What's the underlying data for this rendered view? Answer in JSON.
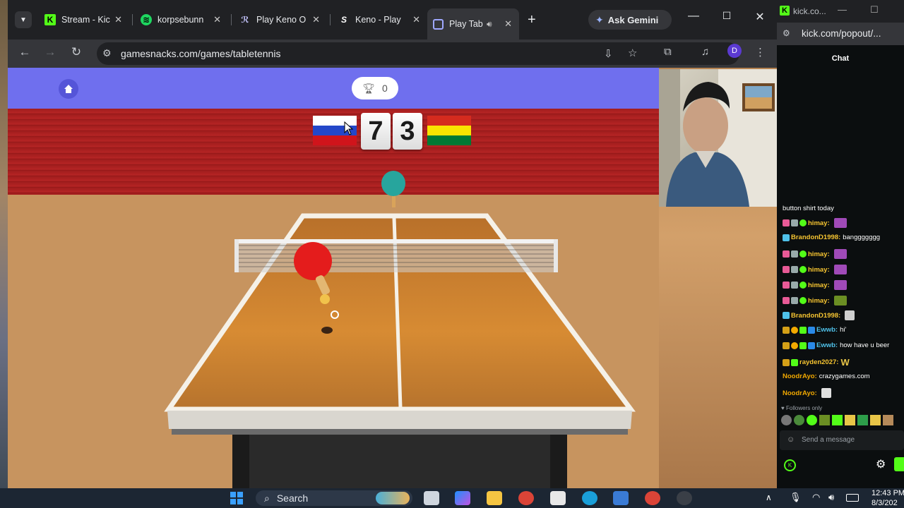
{
  "browser": {
    "tabs": [
      {
        "title": "Stream - Kic",
        "icon": "kick-icon"
      },
      {
        "title": "korpsebunn",
        "icon": "spotify-icon"
      },
      {
        "title": "Play Keno O",
        "icon": "keno-icon"
      },
      {
        "title": "Keno - Play",
        "icon": "stake-icon"
      },
      {
        "title": "Play Tab",
        "icon": "gamesnacks-icon",
        "active": true
      }
    ],
    "new_tab": "+",
    "gemini_label": "Ask Gemini",
    "url": "gamesnacks.com/games/tabletennis",
    "profile_initial": "D"
  },
  "game": {
    "trophy_score": "0",
    "left_flag": "Russia",
    "right_flag": "Bolivia",
    "left_score": "7",
    "right_score": "3"
  },
  "kick": {
    "window_title": "kick.co...",
    "url": "kick.com/popout/...",
    "chat_header": "Chat",
    "messages": [
      {
        "user": "",
        "text": "button shirt today"
      },
      {
        "user": "himay:",
        "text": "",
        "emote": true
      },
      {
        "user": "BrandonD1998:",
        "text": "banggggggg"
      },
      {
        "user": "himay:",
        "text": "",
        "emote": true
      },
      {
        "user": "himay:",
        "text": "",
        "emote": true
      },
      {
        "user": "himay:",
        "text": "",
        "emote": true
      },
      {
        "user": "himay:",
        "text": "",
        "emote": true
      },
      {
        "user": "BrandonD1998:",
        "text": "",
        "emote": true
      },
      {
        "user": "Ewwb:",
        "text": "hi'"
      },
      {
        "user": "Ewwb:",
        "text": "how have u beer"
      },
      {
        "user": "rayden2027:",
        "text": "W"
      },
      {
        "user": "NoodrAyo:",
        "text": "crazygames.com"
      },
      {
        "user": "NoodrAyo:",
        "text": "",
        "emote": true
      }
    ],
    "followers_only": "Followers only",
    "send_placeholder": "Send a message"
  },
  "taskbar": {
    "search_label": "Search",
    "time": "12:43 PM",
    "date": "8/3/202"
  },
  "colors": {
    "header_blue": "#6f6fee",
    "wall_red": "#a11d1d",
    "table_orange": "#d4862a",
    "kick_green": "#53fc18"
  }
}
